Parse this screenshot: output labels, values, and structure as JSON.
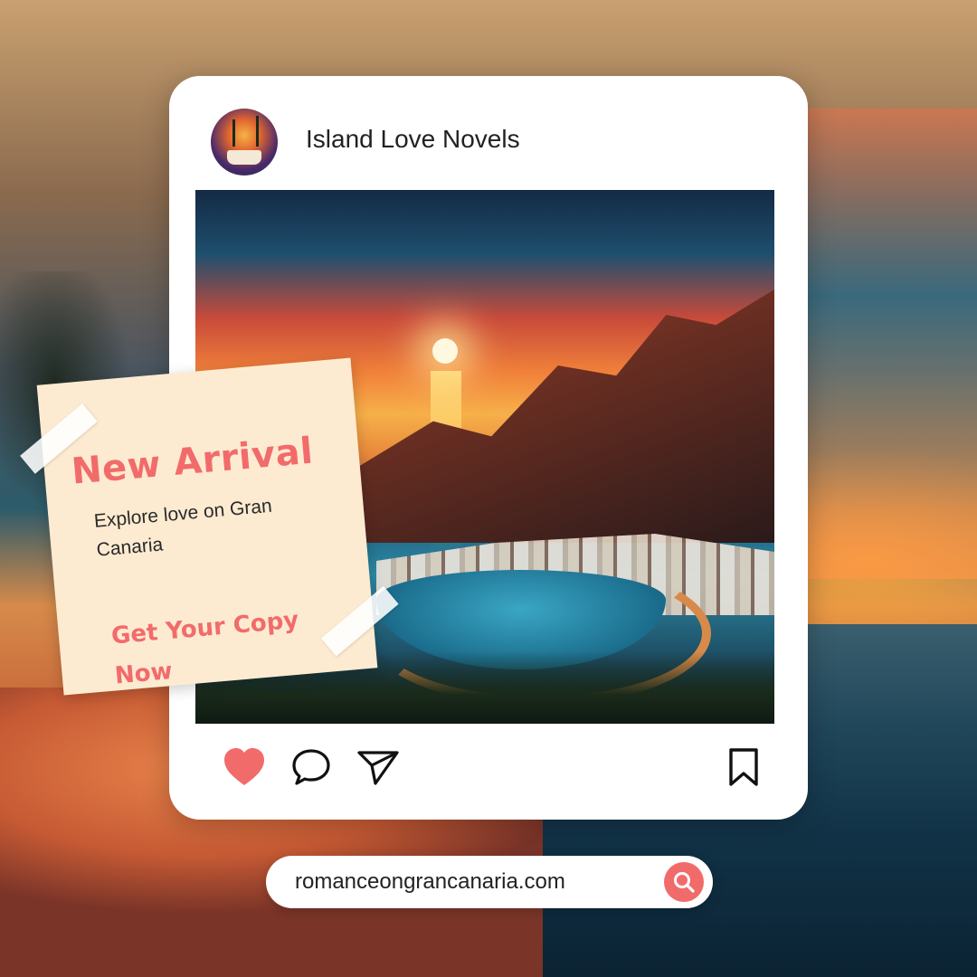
{
  "post": {
    "account_name": "Island Love Novels",
    "avatar_icon": "book-palm-avatar",
    "image_subject": "gran-canaria-sunset-illustration"
  },
  "promo": {
    "title": "New Arrival",
    "subtitle": "Explore love on Gran Canaria",
    "cta": "Get Your Copy Now"
  },
  "actions": {
    "like_icon": "heart-icon",
    "comment_icon": "comment-icon",
    "share_icon": "send-icon",
    "save_icon": "bookmark-icon"
  },
  "search": {
    "text": "romanceongrancanaria.com",
    "icon": "search-icon"
  },
  "colors": {
    "accent": "#f26b6b",
    "note_bg": "#fdebd1",
    "card_bg": "#ffffff"
  }
}
